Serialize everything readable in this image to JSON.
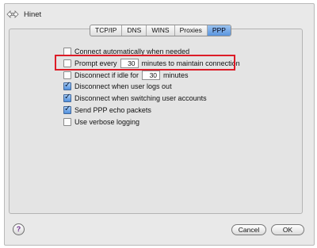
{
  "window": {
    "title": "Hinet",
    "icon": "network-arrows-icon"
  },
  "tabs": [
    {
      "label": "TCP/IP",
      "active": false
    },
    {
      "label": "DNS",
      "active": false
    },
    {
      "label": "WINS",
      "active": false
    },
    {
      "label": "Proxies",
      "active": false
    },
    {
      "label": "PPP",
      "active": true
    }
  ],
  "options": {
    "connect_auto": {
      "label": "Connect automatically when needed",
      "checked": false
    },
    "prompt_every": {
      "label_before": "Prompt every",
      "value": "30",
      "label_after": "minutes to maintain connection",
      "checked": false
    },
    "disconnect_idle": {
      "label_before": "Disconnect if idle for",
      "value": "30",
      "label_after": "minutes",
      "checked": false
    },
    "disconnect_logout": {
      "label": "Disconnect when user logs out",
      "checked": true
    },
    "disconnect_switch": {
      "label": "Disconnect when switching user accounts",
      "checked": true
    },
    "send_echo": {
      "label": "Send PPP echo packets",
      "checked": true
    },
    "verbose_logging": {
      "label": "Use verbose logging",
      "checked": false
    }
  },
  "buttons": {
    "help": "?",
    "cancel": "Cancel",
    "ok": "OK"
  },
  "colors": {
    "highlight": "#dd1c27",
    "accent": "#5b95de"
  }
}
